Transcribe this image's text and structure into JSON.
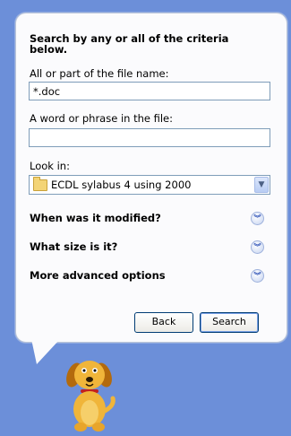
{
  "panel": {
    "title": "Search by any or all of the criteria below.",
    "filename_label": "All or part of the file name:",
    "filename_value": "*.doc",
    "phrase_label": "A word or phrase in the file:",
    "phrase_value": "",
    "lookin_label": "Look in:",
    "lookin_value": "ECDL sylabus 4 using 2000"
  },
  "sections": [
    {
      "label": "When was it modified?"
    },
    {
      "label": "What size is it?"
    },
    {
      "label": "More advanced options"
    }
  ],
  "buttons": {
    "back": "Back",
    "search": "Search"
  },
  "icons": {
    "folder": "folder-icon",
    "dropdown": "chevron-down-icon",
    "expand": "double-chevron-down-icon",
    "assistant": "search-dog-icon"
  },
  "colors": {
    "background": "#6c8fd9",
    "panel": "#fbfbfd",
    "accent": "#2a4eb5"
  }
}
